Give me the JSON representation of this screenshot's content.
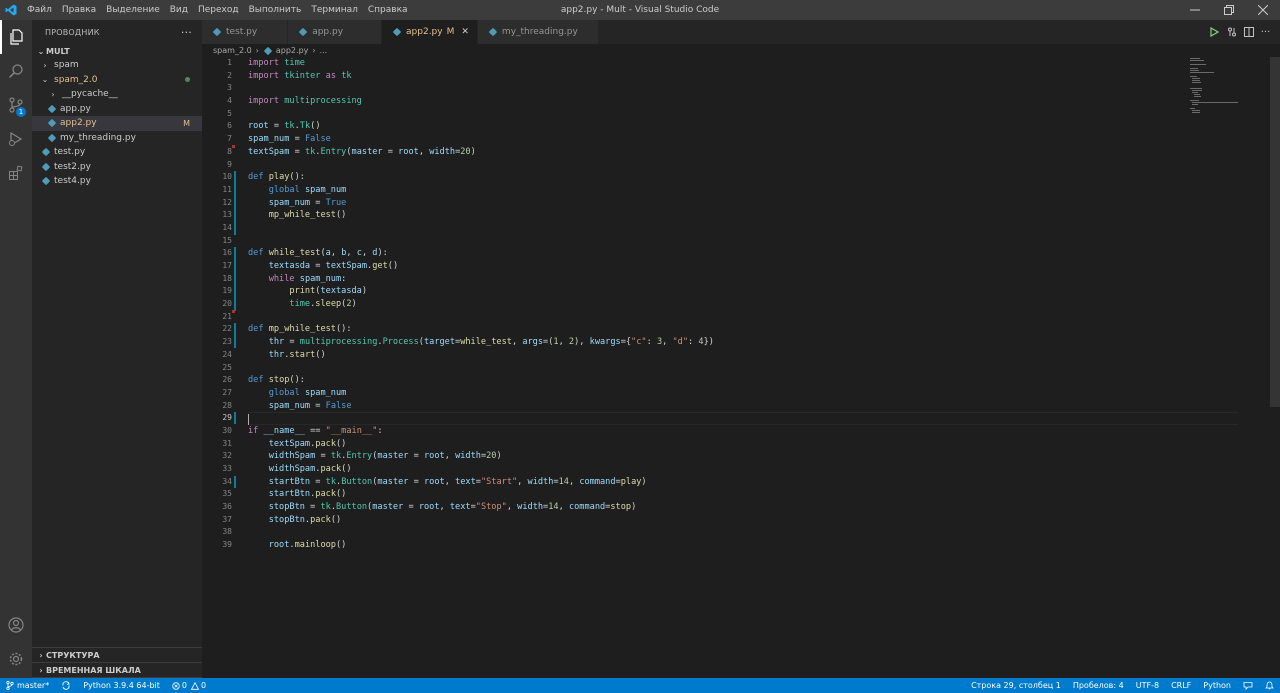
{
  "window": {
    "title": "app2.py - Mult - Visual Studio Code",
    "menu": [
      "Файл",
      "Правка",
      "Выделение",
      "Вид",
      "Переход",
      "Выполнить",
      "Терминал",
      "Справка"
    ]
  },
  "activity": {
    "scm_badge": "1"
  },
  "sidebar": {
    "header": "ПРОВОДНИК",
    "more": "···",
    "root": "MULT",
    "tree": [
      {
        "label": "spam"
      },
      {
        "label": "spam_2.0"
      },
      {
        "label": "__pycache__"
      },
      {
        "label": "app.py"
      },
      {
        "label": "app2.py",
        "status": "M"
      },
      {
        "label": "my_threading.py"
      },
      {
        "label": "test.py"
      },
      {
        "label": "test2.py"
      },
      {
        "label": "test4.py"
      }
    ],
    "outline": "СТРУКТУРА",
    "timeline": "ВРЕМЕННАЯ ШКАЛА"
  },
  "tabs": [
    {
      "label": "test.py"
    },
    {
      "label": "app.py"
    },
    {
      "label": "app2.py",
      "status": "M",
      "close": "✕"
    },
    {
      "label": "my_threading.py"
    }
  ],
  "breadcrumb": {
    "folder": "spam_2.0",
    "file": "app2.py",
    "symbol": "..."
  },
  "editor": {
    "line_numbers": [
      "1",
      "2",
      "3",
      "4",
      "5",
      "6",
      "7",
      "8",
      "9",
      "10",
      "11",
      "12",
      "13",
      "14",
      "15",
      "16",
      "17",
      "18",
      "19",
      "20",
      "21",
      "22",
      "23",
      "24",
      "25",
      "26",
      "27",
      "28",
      "29",
      "30",
      "31",
      "32",
      "33",
      "34",
      "35",
      "36",
      "37",
      "38",
      "39"
    ],
    "current_line": 29
  },
  "status": {
    "branch": "master*",
    "python": "Python 3.9.4 64-bit",
    "problems": "0",
    "warnings": "0",
    "position": "Строка 29, столбец 1",
    "spaces": "Пробелов: 4",
    "encoding": "UTF-8",
    "eol": "CRLF",
    "language": "Python"
  }
}
